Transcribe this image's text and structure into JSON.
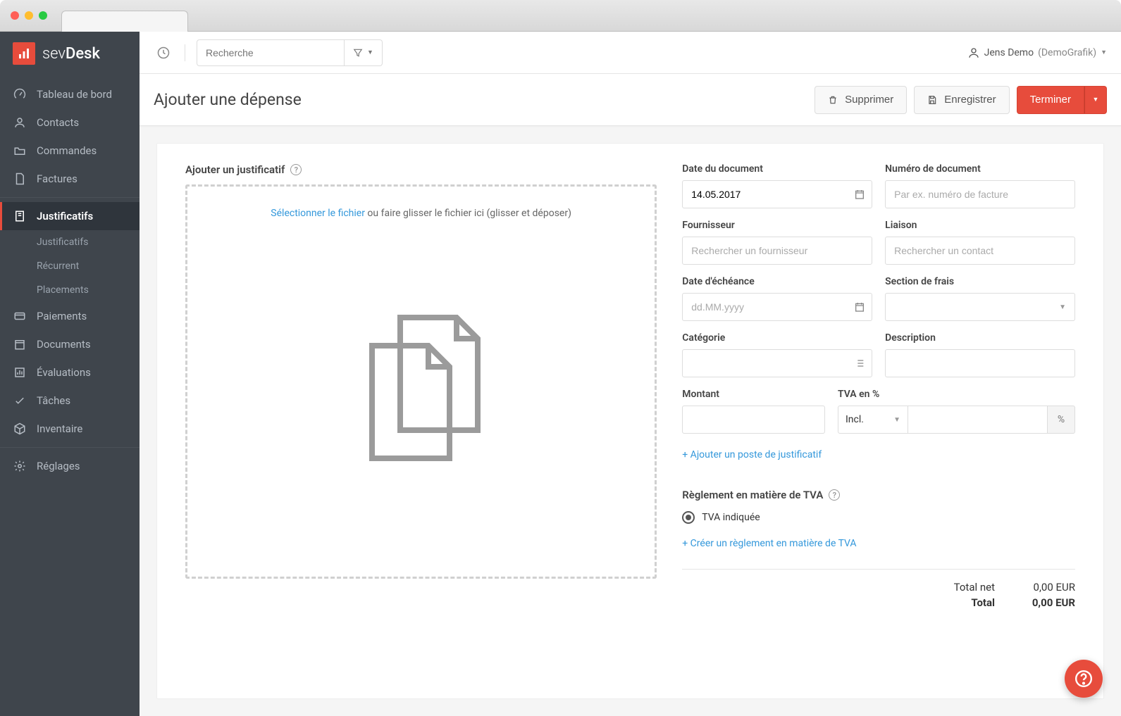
{
  "brand": {
    "name_light": "sev",
    "name_bold": "Desk"
  },
  "topbar": {
    "search_placeholder": "Recherche",
    "user_name": "Jens Demo",
    "user_org": "(DemoGrafik)"
  },
  "sidebar": {
    "items": [
      {
        "id": "dashboard",
        "label": "Tableau de bord"
      },
      {
        "id": "contacts",
        "label": "Contacts"
      },
      {
        "id": "orders",
        "label": "Commandes"
      },
      {
        "id": "invoices",
        "label": "Factures"
      },
      {
        "id": "receipts",
        "label": "Justificatifs",
        "active": true
      },
      {
        "id": "payments",
        "label": "Paiements"
      },
      {
        "id": "documents",
        "label": "Documents"
      },
      {
        "id": "reports",
        "label": "Évaluations"
      },
      {
        "id": "tasks",
        "label": "Tâches"
      },
      {
        "id": "inventory",
        "label": "Inventaire"
      },
      {
        "id": "settings",
        "label": "Réglages"
      }
    ],
    "sub_items": [
      {
        "label": "Justificatifs"
      },
      {
        "label": "Récurrent"
      },
      {
        "label": "Placements"
      }
    ]
  },
  "page": {
    "title": "Ajouter une dépense",
    "actions": {
      "delete": "Supprimer",
      "save": "Enregistrer",
      "finish": "Terminer"
    }
  },
  "upload": {
    "heading": "Ajouter un justificatif",
    "link_text": "Sélectionner le fichier",
    "rest_text": " ou faire glisser le fichier ici (glisser et déposer)"
  },
  "form": {
    "doc_date_label": "Date du document",
    "doc_date_value": "14.05.2017",
    "doc_number_label": "Numéro de document",
    "doc_number_placeholder": "Par ex. numéro de facture",
    "supplier_label": "Fournisseur",
    "supplier_placeholder": "Rechercher un fournisseur",
    "liaison_label": "Liaison",
    "liaison_placeholder": "Rechercher un contact",
    "due_date_label": "Date d'échéance",
    "due_date_placeholder": "dd.MM.yyyy",
    "cost_section_label": "Section de frais",
    "category_label": "Catégorie",
    "description_label": "Description",
    "amount_label": "Montant",
    "vat_pct_label": "TVA en %",
    "vat_incl_option": "Incl.",
    "pct_symbol": "%",
    "add_line": "+ Ajouter un poste de justificatif"
  },
  "tva": {
    "heading": "Règlement en matière de TVA",
    "option_indicated": "TVA indiquée",
    "create_link": "+ Créer un règlement en matière de TVA"
  },
  "totals": {
    "net_label": "Total net",
    "net_value": "0,00 EUR",
    "total_label": "Total",
    "total_value": "0,00 EUR"
  }
}
